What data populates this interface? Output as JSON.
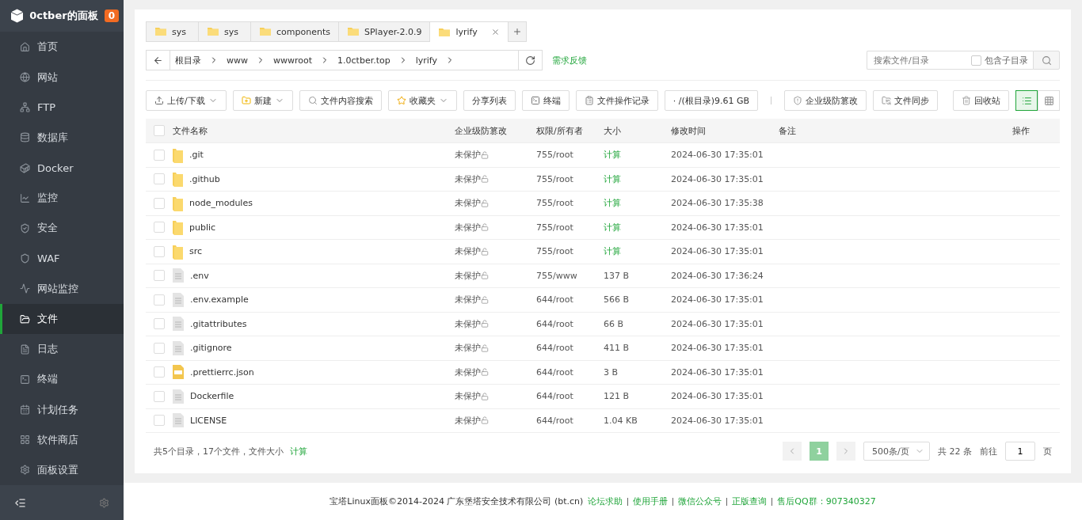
{
  "sidebar": {
    "title": "0ctber的面板",
    "badge": "0",
    "items": [
      {
        "label": "首页",
        "selected": false
      },
      {
        "label": "网站",
        "selected": false
      },
      {
        "label": "FTP",
        "selected": false
      },
      {
        "label": "数据库",
        "selected": false
      },
      {
        "label": "Docker",
        "selected": false
      },
      {
        "label": "监控",
        "selected": false
      },
      {
        "label": "安全",
        "selected": false
      },
      {
        "label": "WAF",
        "selected": false
      },
      {
        "label": "网站监控",
        "selected": false
      },
      {
        "label": "文件",
        "selected": true
      },
      {
        "label": "日志",
        "selected": false
      },
      {
        "label": "终端",
        "selected": false
      },
      {
        "label": "计划任务",
        "selected": false
      },
      {
        "label": "软件商店",
        "selected": false
      },
      {
        "label": "面板设置",
        "selected": false
      }
    ]
  },
  "tabs": [
    {
      "label": "sys",
      "selected": false
    },
    {
      "label": "sys",
      "selected": false
    },
    {
      "label": "components",
      "selected": false
    },
    {
      "label": "SPlayer-2.0.9",
      "selected": false
    },
    {
      "label": "lyrify",
      "selected": true
    }
  ],
  "breadcrumb": [
    "根目录",
    "www",
    "wwwroot",
    "1.0ctber.top",
    "lyrify"
  ],
  "feedback": "需求反馈",
  "search": {
    "placeholder": "搜索文件/目录",
    "subdir_label": "包含子目录",
    "subdir_checked": false
  },
  "toolbar": [
    "上传/下载",
    "新建",
    "文件内容搜索",
    "收藏夹",
    "分享列表",
    "终端",
    "文件操作记录",
    "· /(根目录)9.61 GB",
    "企业级防篡改",
    "文件同步"
  ],
  "recycle": "回收站",
  "view_modes": [
    {
      "selected": true
    },
    {
      "selected": false
    }
  ],
  "table": {
    "all_checked": false,
    "columns": [
      "文件名称",
      "企业级防篡改",
      "权限/所有者",
      "大小",
      "修改时间",
      "备注",
      "操作"
    ],
    "rows": [
      {
        "kind": "folder",
        "name": ".git",
        "protect": "未保护",
        "perm": "755/root",
        "size": "计算",
        "mtime": "2024-06-30 17:35:01",
        "checked": false
      },
      {
        "kind": "folder",
        "name": ".github",
        "protect": "未保护",
        "perm": "755/root",
        "size": "计算",
        "mtime": "2024-06-30 17:35:01",
        "checked": false
      },
      {
        "kind": "folder",
        "name": "node_modules",
        "protect": "未保护",
        "perm": "755/root",
        "size": "计算",
        "mtime": "2024-06-30 17:35:38",
        "checked": false
      },
      {
        "kind": "folder",
        "name": "public",
        "protect": "未保护",
        "perm": "755/root",
        "size": "计算",
        "mtime": "2024-06-30 17:35:01",
        "checked": false
      },
      {
        "kind": "folder",
        "name": "src",
        "protect": "未保护",
        "perm": "755/root",
        "size": "计算",
        "mtime": "2024-06-30 17:35:01",
        "checked": false
      },
      {
        "kind": "file",
        "name": ".env",
        "protect": "未保护",
        "perm": "755/www",
        "size": "137 B",
        "mtime": "2024-06-30 17:36:24",
        "checked": false
      },
      {
        "kind": "file",
        "name": ".env.example",
        "protect": "未保护",
        "perm": "644/root",
        "size": "566 B",
        "mtime": "2024-06-30 17:35:01",
        "checked": false
      },
      {
        "kind": "file",
        "name": ".gitattributes",
        "protect": "未保护",
        "perm": "644/root",
        "size": "66 B",
        "mtime": "2024-06-30 17:35:01",
        "checked": false
      },
      {
        "kind": "file",
        "name": ".gitignore",
        "protect": "未保护",
        "perm": "644/root",
        "size": "411 B",
        "mtime": "2024-06-30 17:35:01",
        "checked": false
      },
      {
        "kind": "json",
        "name": ".prettierrc.json",
        "protect": "未保护",
        "perm": "644/root",
        "size": "3 B",
        "mtime": "2024-06-30 17:35:01",
        "checked": false
      },
      {
        "kind": "file",
        "name": "Dockerfile",
        "protect": "未保护",
        "perm": "644/root",
        "size": "121 B",
        "mtime": "2024-06-30 17:35:01",
        "checked": false
      },
      {
        "kind": "file",
        "name": "LICENSE",
        "protect": "未保护",
        "perm": "644/root",
        "size": "1.04 KB",
        "mtime": "2024-06-30 17:35:01",
        "checked": false
      }
    ]
  },
  "summary": {
    "text": "共5个目录，17个文件，文件大小",
    "link": "计算"
  },
  "pagination": {
    "pages": [
      {
        "label": "1",
        "selected": true
      }
    ],
    "page_size": "500条/页",
    "total": "共 22 条",
    "goto_label": "前往",
    "goto_value": "1",
    "page_unit": "页"
  },
  "footer": {
    "text": "宝塔Linux面板©2014-2024 广东堡塔安全技术有限公司 (bt.cn)",
    "links": [
      "论坛求助",
      "使用手册",
      "微信公众号",
      "正版查询",
      "售后QQ群：907340327"
    ]
  }
}
